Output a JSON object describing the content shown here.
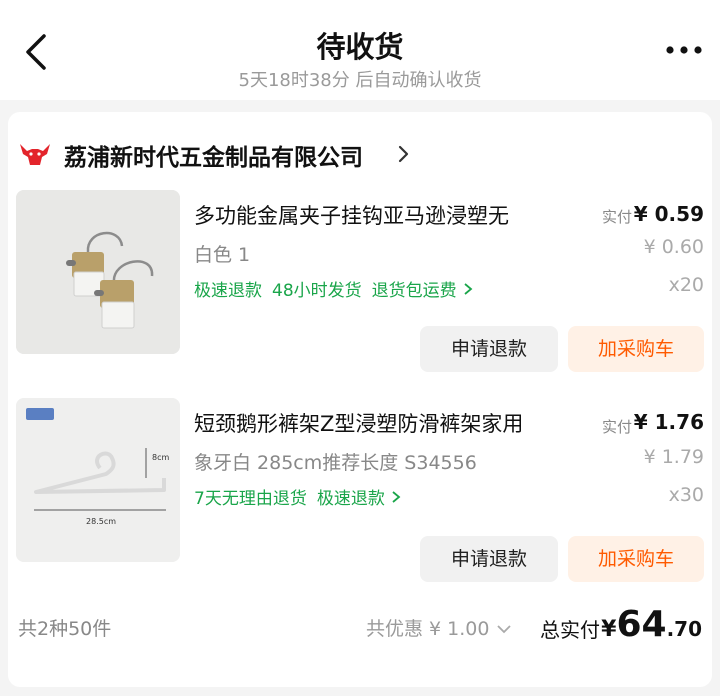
{
  "header": {
    "title": "待收货",
    "subtitle": "5天18时38分 后自动确认收货"
  },
  "store": {
    "name": "荔浦新时代五金制品有限公司"
  },
  "products": [
    {
      "name": "多功能金属夹子挂钩亚马逊浸塑无",
      "spec": "白色 1",
      "tags": [
        "极速退款",
        "48小时发货",
        "退货包运费"
      ],
      "pay_label": "实付",
      "pay_amount": "¥ 0.59",
      "original_price": "¥ 0.60",
      "quantity": "x20",
      "refund_label": "申请退款",
      "cart_label": "加采购车"
    },
    {
      "name": "短颈鹅形裤架Z型浸塑防滑裤架家用",
      "spec": "象牙白 285cm推荐长度 S34556",
      "tags": [
        "7天无理由退货",
        "极速退款"
      ],
      "pay_label": "实付",
      "pay_amount": "¥ 1.76",
      "original_price": "¥ 1.79",
      "quantity": "x30",
      "refund_label": "申请退款",
      "cart_label": "加采购车",
      "image_labels": {
        "height": "8cm",
        "width": "28.5cm"
      }
    }
  ],
  "footer": {
    "count": "共2种50件",
    "discount": "共优惠 ¥ 1.00",
    "total_label": "总实付",
    "total_yen": "¥",
    "total_int": "64",
    "total_dec": ".70"
  },
  "colors": {
    "accent": "#ff5a00",
    "tag_green": "#1aa54a",
    "logo_red": "#e3242b"
  }
}
